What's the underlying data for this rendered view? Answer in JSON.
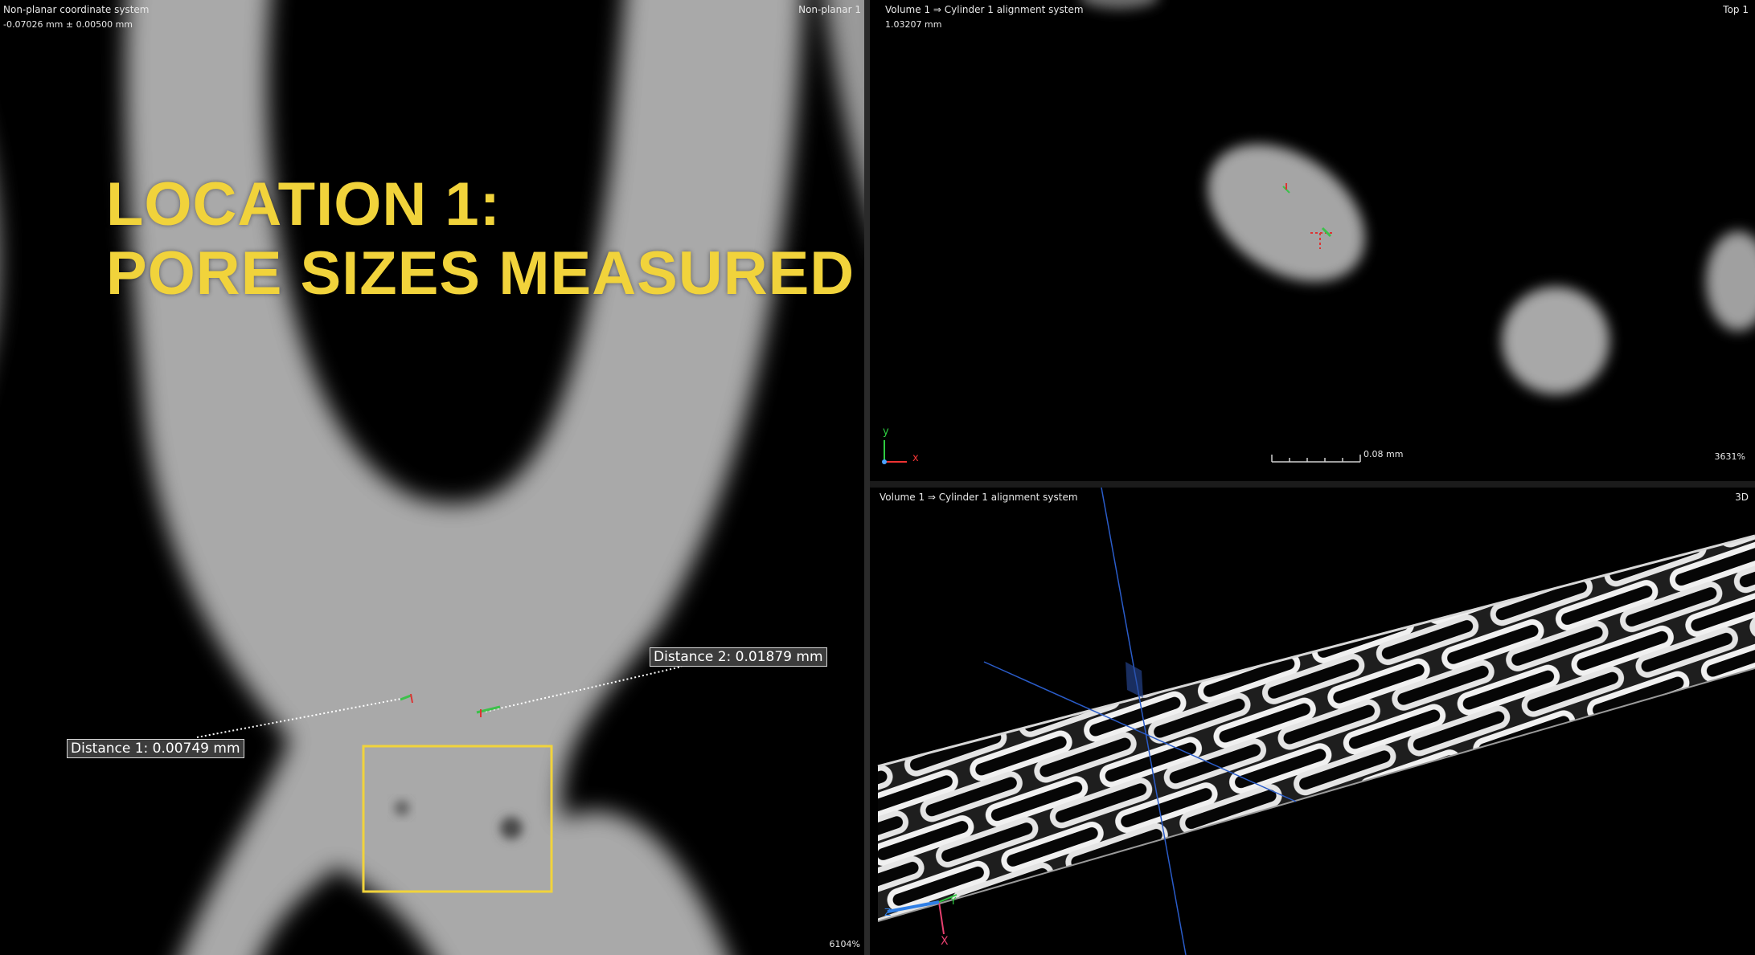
{
  "left_view": {
    "coordinate_system": "Non-planar coordinate system",
    "value_readout": "-0.07026 mm ± 0.00500 mm",
    "view_name": "Non-planar 1",
    "zoom": "6104%",
    "title_line1": "LOCATION 1:",
    "title_line2": "PORE SIZES MEASURED",
    "distance1": "Distance 1: 0.00749 mm",
    "distance2": "Distance 2: 0.01879 mm"
  },
  "top_right_view": {
    "title": "Volume 1 ⇒ Cylinder 1 alignment system",
    "value_readout": "1.03207 mm",
    "view_name": "Top 1",
    "scale_label": "0.08 mm",
    "zoom": "3631%",
    "axis_y": "y",
    "axis_x": "x"
  },
  "bottom_right_view": {
    "title": "Volume 1 ⇒ Cylinder 1 alignment system",
    "view_name": "3D",
    "axis_y": "Y",
    "axis_x": "X",
    "axis_z": "Z"
  },
  "colors": {
    "title_yellow": "#f1d33b",
    "highlight_box": "#f1d33b",
    "grayscale_material": "#a9a9a9"
  }
}
